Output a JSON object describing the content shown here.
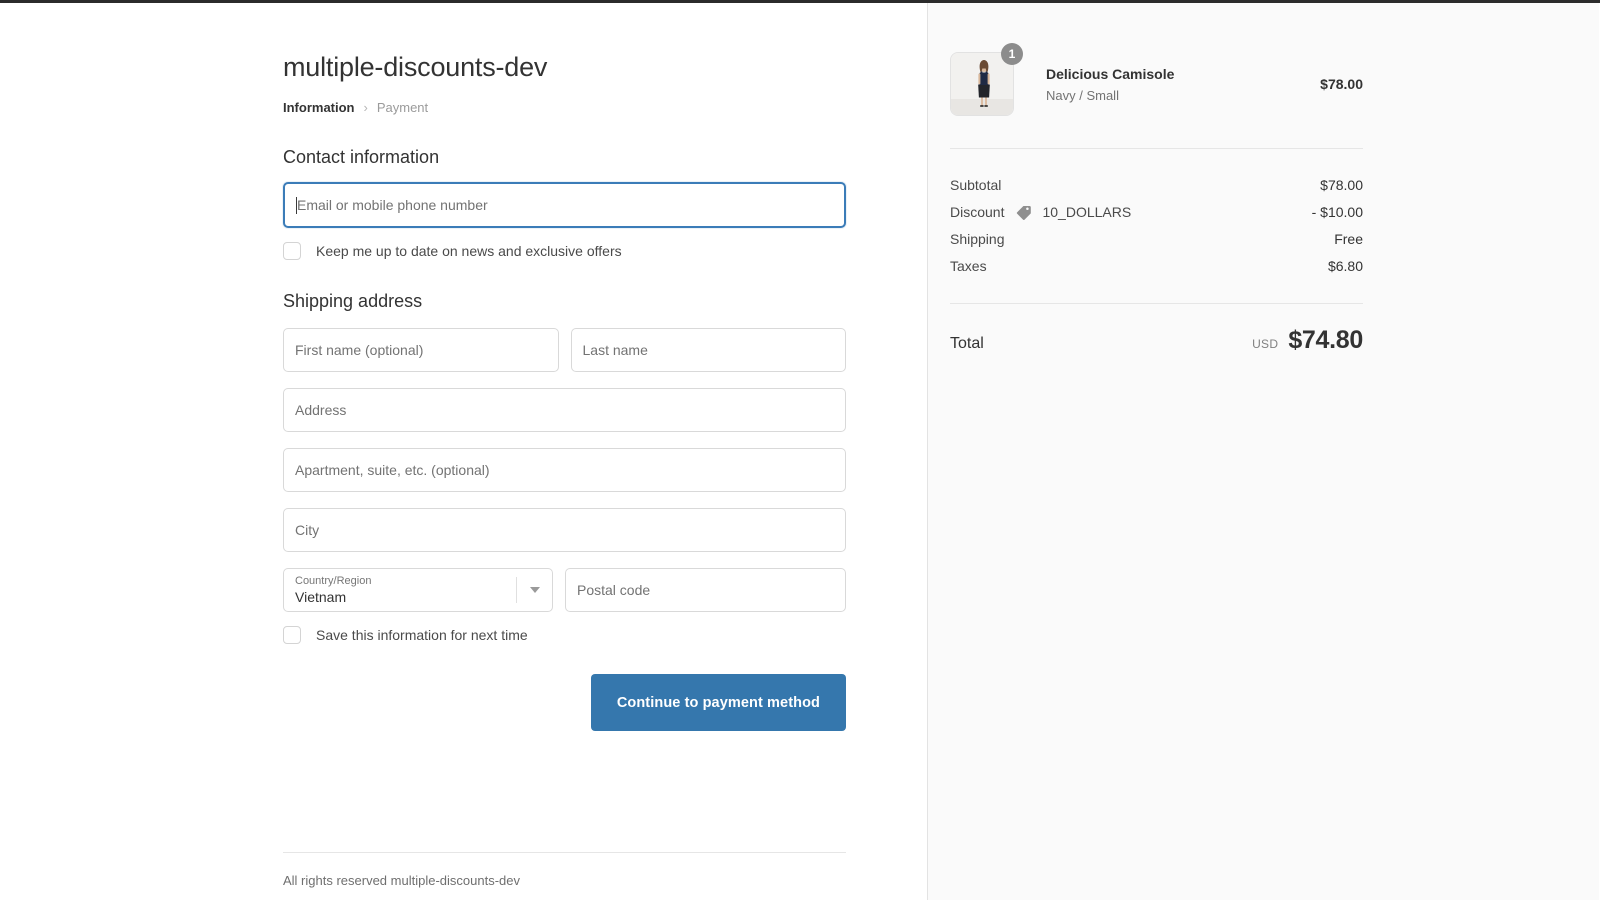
{
  "window": {
    "accent_color": "#3577ad",
    "focus_border_color": "#3b7cb8",
    "panel_bg": "#fafafa"
  },
  "header": {
    "shop_title": "multiple-discounts-dev",
    "breadcrumb": {
      "current": "Information",
      "separator": "›",
      "next": "Payment"
    }
  },
  "contact": {
    "section_title": "Contact information",
    "email": {
      "placeholder": "Email or mobile phone number",
      "value": "",
      "focused": true
    },
    "newsletter_checkbox": {
      "label": "Keep me up to date on news and exclusive offers",
      "checked": false
    }
  },
  "shipping": {
    "section_title": "Shipping address",
    "first_name": {
      "placeholder": "First name (optional)",
      "value": ""
    },
    "last_name": {
      "placeholder": "Last name",
      "value": ""
    },
    "address": {
      "placeholder": "Address",
      "value": ""
    },
    "apartment": {
      "placeholder": "Apartment, suite, etc. (optional)",
      "value": ""
    },
    "city": {
      "placeholder": "City",
      "value": ""
    },
    "country": {
      "label": "Country/Region",
      "value": "Vietnam"
    },
    "postal_code": {
      "placeholder": "Postal code",
      "value": ""
    },
    "save_checkbox": {
      "label": "Save this information for next time",
      "checked": false
    }
  },
  "actions": {
    "continue_label": "Continue to payment method"
  },
  "footer": {
    "text": "All rights reserved multiple-discounts-dev"
  },
  "order_summary": {
    "line_items": [
      {
        "name": "Delicious Camisole",
        "variant": "Navy / Small",
        "quantity": "1",
        "price": "$78.00",
        "thumb_icon": "product-photo-woman-in-navy-dress"
      }
    ],
    "totals": [
      {
        "label": "Subtotal",
        "value": "$78.00",
        "icon": null,
        "code": null
      },
      {
        "label": "Discount",
        "value": "- $10.00",
        "icon": "tag-icon",
        "code": "10_DOLLARS"
      },
      {
        "label": "Shipping",
        "value": "Free",
        "icon": null,
        "code": null
      },
      {
        "label": "Taxes",
        "value": "$6.80",
        "icon": null,
        "code": null
      }
    ],
    "grand_total": {
      "label": "Total",
      "currency": "USD",
      "amount": "$74.80"
    }
  }
}
